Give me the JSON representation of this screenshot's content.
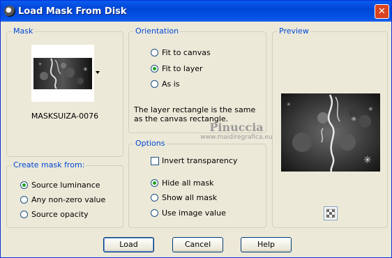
{
  "window": {
    "title": "Load Mask From Disk",
    "close_icon": "close-icon"
  },
  "mask_group": {
    "legend": "Mask",
    "mask_name": "MASKSUIZA-0076"
  },
  "create_group": {
    "legend": "Create mask from:",
    "options": [
      {
        "label": "Source luminance",
        "selected": true
      },
      {
        "label": "Any non-zero value",
        "selected": false
      },
      {
        "label": "Source opacity",
        "selected": false
      }
    ]
  },
  "orientation_group": {
    "legend": "Orientation",
    "options": [
      {
        "label": "Fit to canvas",
        "selected": false
      },
      {
        "label": "Fit to layer",
        "selected": true
      },
      {
        "label": "As is",
        "selected": false
      }
    ],
    "note": "The layer rectangle is the same as the canvas rectangle."
  },
  "options_group": {
    "legend": "Options",
    "invert_label": "Invert transparency",
    "invert_checked": false,
    "options": [
      {
        "label": "Hide all mask",
        "selected": true
      },
      {
        "label": "Show all mask",
        "selected": false
      },
      {
        "label": "Use image value",
        "selected": false
      }
    ]
  },
  "preview_group": {
    "legend": "Preview",
    "toggle_icon": "checkerboard-icon"
  },
  "watermark": {
    "name": "Pinuccia",
    "site": "www.maidiregrafica.eu"
  },
  "buttons": {
    "load": "Load",
    "cancel": "Cancel",
    "help": "Help"
  }
}
